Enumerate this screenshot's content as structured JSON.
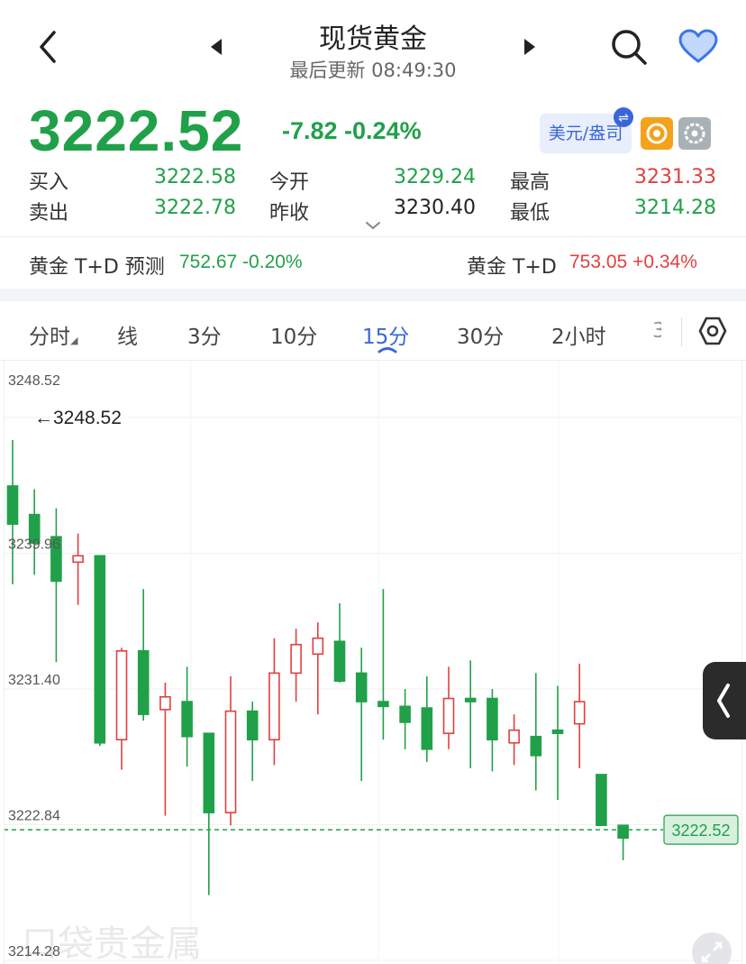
{
  "header": {
    "title": "现货黄金",
    "updated": "最后更新 08:49:30"
  },
  "quote": {
    "price": "3222.52",
    "change": "-7.82 -0.24%",
    "currency_label": "美元/盎司",
    "currency_badge": "⇌"
  },
  "stats": {
    "buy_label": "买入",
    "buy": "3222.58",
    "sell_label": "卖出",
    "sell": "3222.78",
    "open_label": "今开",
    "open": "3229.24",
    "prev_close_label": "昨收",
    "prev_close": "3230.40",
    "high_label": "最高",
    "high": "3231.33",
    "low_label": "最低",
    "low": "3214.28"
  },
  "td": {
    "forecast_label": "黄金 T+D 预测",
    "forecast_value": "752.67 -0.20%",
    "label": "黄金 T+D",
    "value": "753.05 +0.34%"
  },
  "tabs": [
    {
      "label": "分时"
    },
    {
      "label": "日线"
    },
    {
      "label": "3分"
    },
    {
      "label": "10分"
    },
    {
      "label": "15分"
    },
    {
      "label": "30分"
    },
    {
      "label": "2小时"
    },
    {
      "label": "3"
    }
  ],
  "colors": {
    "up": "#e0403f",
    "down": "#21a04a",
    "accent": "#3a66d8"
  },
  "chart_data": {
    "type": "candlestick",
    "y_ticks": [
      "3248.52",
      "3239.96",
      "3231.40",
      "3222.84",
      "3214.28"
    ],
    "max_label": "3248.52",
    "current_label": "3222.52",
    "current_value": 3222.52,
    "ylim": [
      3214.28,
      3248.52
    ],
    "candles": [
      {
        "o": 3244.2,
        "h": 3247.1,
        "l": 3238.0,
        "c": 3241.8
      },
      {
        "o": 3242.4,
        "h": 3244.0,
        "l": 3238.6,
        "c": 3240.6
      },
      {
        "o": 3241.0,
        "h": 3242.8,
        "l": 3233.1,
        "c": 3238.2
      },
      {
        "o": 3239.4,
        "h": 3241.2,
        "l": 3236.7,
        "c": 3239.8
      },
      {
        "o": 3239.8,
        "h": 3239.8,
        "l": 3227.8,
        "c": 3228.0
      },
      {
        "o": 3228.2,
        "h": 3234.0,
        "l": 3226.3,
        "c": 3233.8
      },
      {
        "o": 3233.8,
        "h": 3237.7,
        "l": 3229.4,
        "c": 3229.8
      },
      {
        "o": 3230.1,
        "h": 3231.8,
        "l": 3223.4,
        "c": 3230.9
      },
      {
        "o": 3230.6,
        "h": 3232.8,
        "l": 3226.5,
        "c": 3228.4
      },
      {
        "o": 3228.6,
        "h": 3228.6,
        "l": 3218.4,
        "c": 3223.6
      },
      {
        "o": 3223.6,
        "h": 3232.2,
        "l": 3222.8,
        "c": 3230.0
      },
      {
        "o": 3230.0,
        "h": 3230.6,
        "l": 3225.6,
        "c": 3228.2
      },
      {
        "o": 3228.2,
        "h": 3234.6,
        "l": 3226.6,
        "c": 3232.4
      },
      {
        "o": 3232.4,
        "h": 3235.2,
        "l": 3230.6,
        "c": 3234.2
      },
      {
        "o": 3233.6,
        "h": 3235.6,
        "l": 3229.8,
        "c": 3234.6
      },
      {
        "o": 3234.4,
        "h": 3236.8,
        "l": 3231.8,
        "c": 3231.9
      },
      {
        "o": 3232.4,
        "h": 3234.0,
        "l": 3225.6,
        "c": 3230.6
      },
      {
        "o": 3230.6,
        "h": 3237.7,
        "l": 3228.2,
        "c": 3230.3
      },
      {
        "o": 3230.3,
        "h": 3231.4,
        "l": 3227.6,
        "c": 3229.3
      },
      {
        "o": 3230.2,
        "h": 3232.2,
        "l": 3226.8,
        "c": 3227.6
      },
      {
        "o": 3228.6,
        "h": 3232.8,
        "l": 3227.6,
        "c": 3230.8
      },
      {
        "o": 3230.8,
        "h": 3233.2,
        "l": 3226.4,
        "c": 3230.6
      },
      {
        "o": 3230.8,
        "h": 3231.4,
        "l": 3226.2,
        "c": 3228.2
      },
      {
        "o": 3228.0,
        "h": 3229.8,
        "l": 3226.6,
        "c": 3228.8
      },
      {
        "o": 3228.4,
        "h": 3232.4,
        "l": 3225.0,
        "c": 3227.2
      },
      {
        "o": 3228.8,
        "h": 3231.6,
        "l": 3224.4,
        "c": 3228.6
      },
      {
        "o": 3229.2,
        "h": 3233.0,
        "l": 3226.4,
        "c": 3230.6
      },
      {
        "o": 3226.0,
        "h": 3226.0,
        "l": 3222.8,
        "c": 3222.8
      },
      {
        "o": 3222.8,
        "h": 3222.8,
        "l": 3220.6,
        "c": 3222.0
      }
    ]
  }
}
